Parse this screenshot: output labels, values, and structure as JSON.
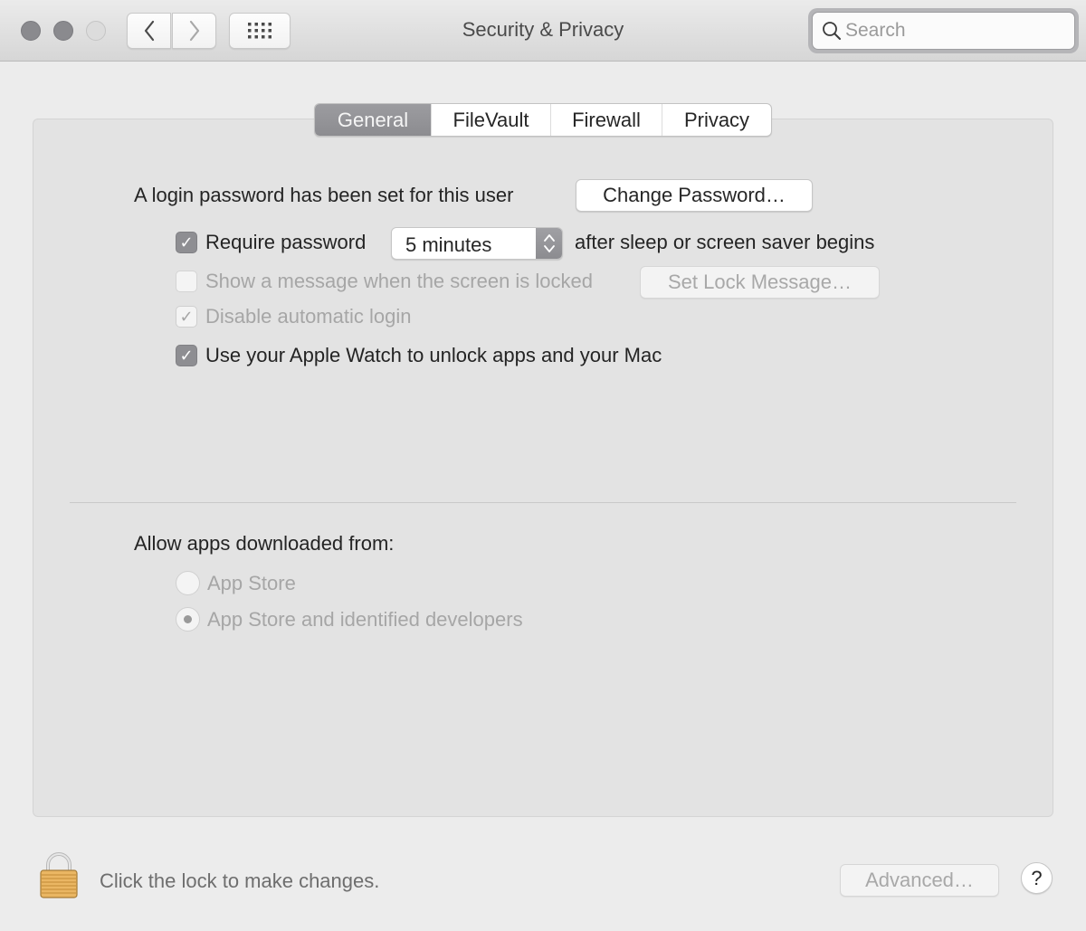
{
  "window": {
    "title": "Security & Privacy",
    "traffic_lights": [
      "close",
      "minimize",
      "zoom"
    ],
    "search": {
      "placeholder": "Search",
      "value": ""
    },
    "toolbar_icons": {
      "back": "chevron-left-icon",
      "forward": "chevron-right-icon",
      "show_all": "grid-icon"
    }
  },
  "tabs": [
    {
      "label": "General",
      "active": true
    },
    {
      "label": "FileVault",
      "active": false
    },
    {
      "label": "Firewall",
      "active": false
    },
    {
      "label": "Privacy",
      "active": false
    }
  ],
  "general": {
    "login_password_text": "A login password has been set for this user",
    "change_password_label": "Change Password…",
    "require_password": {
      "label": "Require password",
      "checked": true
    },
    "require_password_delay": {
      "value": "5 minutes"
    },
    "after_sleep_text": "after sleep or screen saver begins",
    "show_message": {
      "label": "Show a message when the screen is locked",
      "checked": false,
      "enabled": false
    },
    "set_lock_message_label": "Set Lock Message…",
    "disable_auto_login": {
      "label": "Disable automatic login",
      "checked": true,
      "enabled": false
    },
    "apple_watch": {
      "label": "Use your Apple Watch to unlock apps and your Mac",
      "checked": true
    },
    "allow_apps_heading": "Allow apps downloaded from:",
    "allow_apps_options": [
      {
        "label": "App Store",
        "selected": false,
        "enabled": false
      },
      {
        "label": "App Store and identified developers",
        "selected": true,
        "enabled": false
      }
    ]
  },
  "footer": {
    "lock_icon": "lock-icon",
    "lock_text": "Click the lock to make changes.",
    "advanced_label": "Advanced…",
    "help_label": "?"
  },
  "check_glyph": "✓"
}
